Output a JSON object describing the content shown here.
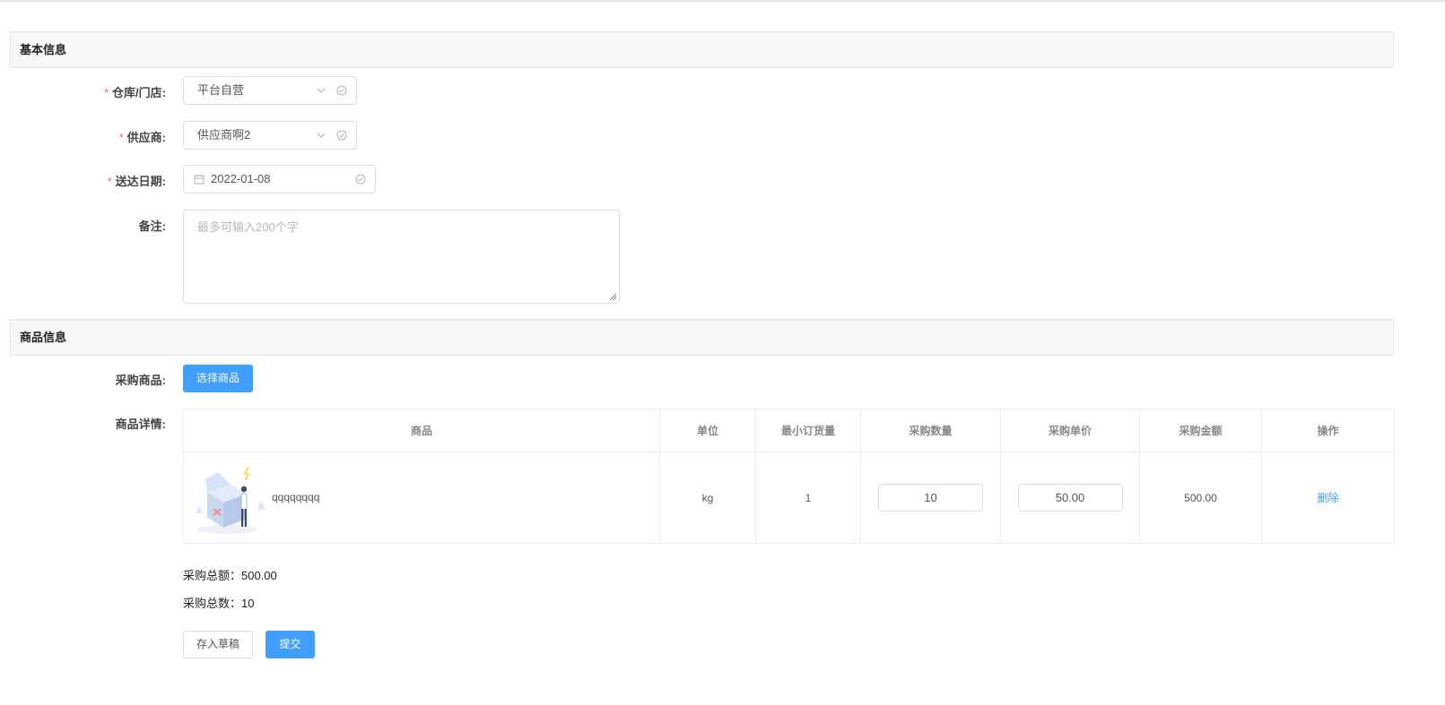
{
  "basic_section": {
    "title": "基本信息"
  },
  "warehouse": {
    "label": "仓库/门店:",
    "required": "*",
    "value": "平台自营"
  },
  "supplier": {
    "label": "供应商:",
    "required": "*",
    "value": "供应商啊2"
  },
  "delivery_date": {
    "label": "送达日期:",
    "required": "*",
    "value": "2022-01-08"
  },
  "remark": {
    "label": "备注:",
    "placeholder": "最多可输入200个字"
  },
  "goods_section": {
    "title": "商品信息"
  },
  "purchase_goods": {
    "label": "采购商品:",
    "button": "选择商品"
  },
  "goods_detail": {
    "label": "商品详情:",
    "columns": [
      "商品",
      "单位",
      "最小订货量",
      "采购数量",
      "采购单价",
      "采购金额",
      "操作"
    ],
    "rows": [
      {
        "name": "qqqqqqqq",
        "unit": "kg",
        "min_order": "1",
        "quantity": "10",
        "unit_price": "50.00",
        "amount": "500.00",
        "action": "删除"
      }
    ]
  },
  "totals": {
    "amount": "采购总额：500.00",
    "count": "采购总数：10"
  },
  "actions": {
    "draft": "存入草稿",
    "submit": "提交"
  },
  "colors": {
    "primary": "#409eff",
    "required": "#f56c6c",
    "header_bg": "#f7f7f7"
  }
}
